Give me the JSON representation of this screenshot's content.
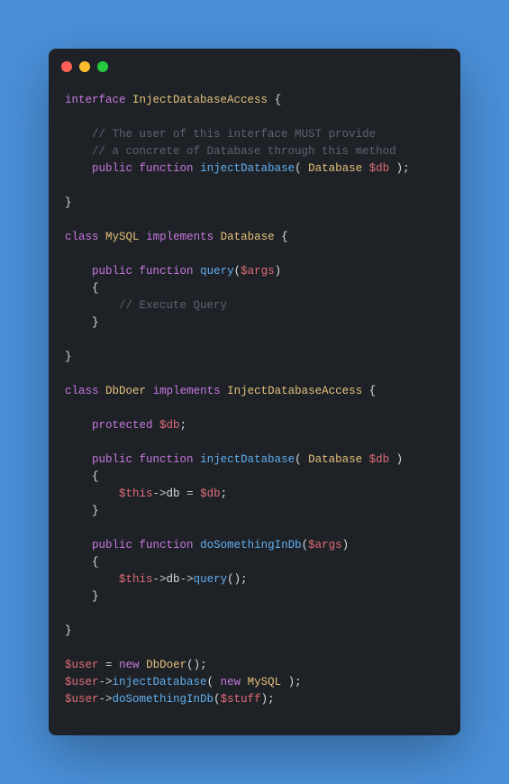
{
  "colors": {
    "background": "#4a90d9",
    "window": "#1e2227",
    "dot_red": "#ff5f56",
    "dot_yellow": "#ffbd2e",
    "dot_green": "#27c93f",
    "keyword": "#c678dd",
    "type": "#e5c07b",
    "function": "#61afef",
    "variable": "#e06c75",
    "comment": "#5c6370",
    "text": "#d7dce2"
  },
  "code": {
    "lines": [
      [
        [
          "kw",
          "interface"
        ],
        [
          "pun",
          " "
        ],
        [
          "typ",
          "InjectDatabaseAccess"
        ],
        [
          "pun",
          " {"
        ]
      ],
      [],
      [
        [
          "pun",
          "    "
        ],
        [
          "cmt",
          "// The user of this interface MUST provide"
        ]
      ],
      [
        [
          "pun",
          "    "
        ],
        [
          "cmt",
          "// a concrete of Database through this method"
        ]
      ],
      [
        [
          "pun",
          "    "
        ],
        [
          "kw",
          "public"
        ],
        [
          "pun",
          " "
        ],
        [
          "kw",
          "function"
        ],
        [
          "pun",
          " "
        ],
        [
          "fn",
          "injectDatabase"
        ],
        [
          "pun",
          "( "
        ],
        [
          "typ",
          "Database"
        ],
        [
          "pun",
          " "
        ],
        [
          "var",
          "$db"
        ],
        [
          "pun",
          " );"
        ]
      ],
      [],
      [
        [
          "pun",
          "}"
        ]
      ],
      [],
      [
        [
          "kw",
          "class"
        ],
        [
          "pun",
          " "
        ],
        [
          "typ",
          "MySQL"
        ],
        [
          "pun",
          " "
        ],
        [
          "kw",
          "implements"
        ],
        [
          "pun",
          " "
        ],
        [
          "typ",
          "Database"
        ],
        [
          "pun",
          " {"
        ]
      ],
      [],
      [
        [
          "pun",
          "    "
        ],
        [
          "kw",
          "public"
        ],
        [
          "pun",
          " "
        ],
        [
          "kw",
          "function"
        ],
        [
          "pun",
          " "
        ],
        [
          "fn",
          "query"
        ],
        [
          "pun",
          "("
        ],
        [
          "var",
          "$args"
        ],
        [
          "pun",
          ")"
        ]
      ],
      [
        [
          "pun",
          "    {"
        ]
      ],
      [
        [
          "pun",
          "        "
        ],
        [
          "cmt",
          "// Execute Query"
        ]
      ],
      [
        [
          "pun",
          "    }"
        ]
      ],
      [],
      [
        [
          "pun",
          "}"
        ]
      ],
      [],
      [
        [
          "kw",
          "class"
        ],
        [
          "pun",
          " "
        ],
        [
          "typ",
          "DbDoer"
        ],
        [
          "pun",
          " "
        ],
        [
          "kw",
          "implements"
        ],
        [
          "pun",
          " "
        ],
        [
          "typ",
          "InjectDatabaseAccess"
        ],
        [
          "pun",
          " {"
        ]
      ],
      [],
      [
        [
          "pun",
          "    "
        ],
        [
          "kw",
          "protected"
        ],
        [
          "pun",
          " "
        ],
        [
          "var",
          "$db"
        ],
        [
          "pun",
          ";"
        ]
      ],
      [],
      [
        [
          "pun",
          "    "
        ],
        [
          "kw",
          "public"
        ],
        [
          "pun",
          " "
        ],
        [
          "kw",
          "function"
        ],
        [
          "pun",
          " "
        ],
        [
          "fn",
          "injectDatabase"
        ],
        [
          "pun",
          "( "
        ],
        [
          "typ",
          "Database"
        ],
        [
          "pun",
          " "
        ],
        [
          "var",
          "$db"
        ],
        [
          "pun",
          " )"
        ]
      ],
      [
        [
          "pun",
          "    {"
        ]
      ],
      [
        [
          "pun",
          "        "
        ],
        [
          "var",
          "$this"
        ],
        [
          "op",
          "->"
        ],
        [
          "pun",
          "db "
        ],
        [
          "op",
          "="
        ],
        [
          "pun",
          " "
        ],
        [
          "var",
          "$db"
        ],
        [
          "pun",
          ";"
        ]
      ],
      [
        [
          "pun",
          "    }"
        ]
      ],
      [],
      [
        [
          "pun",
          "    "
        ],
        [
          "kw",
          "public"
        ],
        [
          "pun",
          " "
        ],
        [
          "kw",
          "function"
        ],
        [
          "pun",
          " "
        ],
        [
          "fn",
          "doSomethingInDb"
        ],
        [
          "pun",
          "("
        ],
        [
          "var",
          "$args"
        ],
        [
          "pun",
          ")"
        ]
      ],
      [
        [
          "pun",
          "    {"
        ]
      ],
      [
        [
          "pun",
          "        "
        ],
        [
          "var",
          "$this"
        ],
        [
          "op",
          "->"
        ],
        [
          "pun",
          "db"
        ],
        [
          "op",
          "->"
        ],
        [
          "fn",
          "query"
        ],
        [
          "pun",
          "();"
        ]
      ],
      [
        [
          "pun",
          "    }"
        ]
      ],
      [],
      [
        [
          "pun",
          "}"
        ]
      ],
      [],
      [
        [
          "var",
          "$user"
        ],
        [
          "pun",
          " "
        ],
        [
          "op",
          "="
        ],
        [
          "pun",
          " "
        ],
        [
          "kw",
          "new"
        ],
        [
          "pun",
          " "
        ],
        [
          "typ",
          "DbDoer"
        ],
        [
          "pun",
          "();"
        ]
      ],
      [
        [
          "var",
          "$user"
        ],
        [
          "op",
          "->"
        ],
        [
          "fn",
          "injectDatabase"
        ],
        [
          "pun",
          "( "
        ],
        [
          "kw",
          "new"
        ],
        [
          "pun",
          " "
        ],
        [
          "typ",
          "MySQL"
        ],
        [
          "pun",
          " );"
        ]
      ],
      [
        [
          "var",
          "$user"
        ],
        [
          "op",
          "->"
        ],
        [
          "fn",
          "doSomethingInDb"
        ],
        [
          "pun",
          "("
        ],
        [
          "var",
          "$stuff"
        ],
        [
          "pun",
          ");"
        ]
      ]
    ]
  }
}
